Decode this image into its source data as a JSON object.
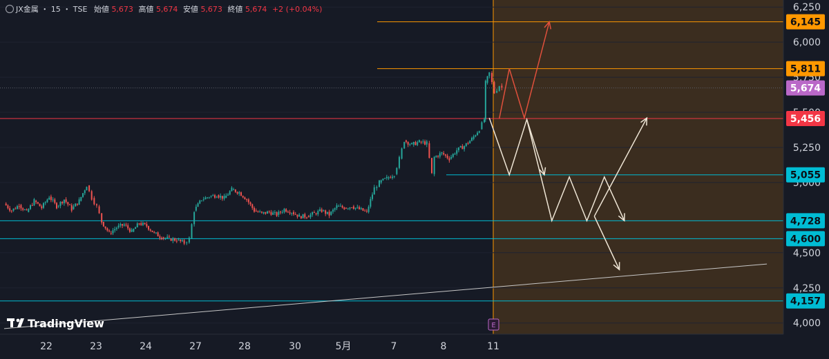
{
  "header": {
    "symbol": "JX金属",
    "interval": "15",
    "exchange": "TSE",
    "sep": "・",
    "open_label": "始値",
    "open_value": "5,673",
    "high_label": "高値",
    "high_value": "5,674",
    "low_label": "安値",
    "low_value": "5,673",
    "close_label": "終値",
    "close_value": "5,674",
    "change": "+2 (+0.04%)"
  },
  "logo": {
    "text": "TradingView"
  },
  "event_marker": {
    "label": "E"
  },
  "chart_data": {
    "type": "candlestick",
    "x_ticks": [
      "22",
      "23",
      "24",
      "27",
      "28",
      "30",
      "5月",
      "7",
      "8",
      "11"
    ],
    "y_ticks": [
      4000,
      4250,
      4500,
      5000,
      5250,
      5500,
      5750,
      6000,
      6250
    ],
    "y_tick_labels": [
      "4,000",
      "4,250",
      "4,500",
      "5,000",
      "5,250",
      "5,500",
      "5,750",
      "6,000",
      "6,250"
    ],
    "ylim": [
      3920,
      6300
    ],
    "last_price": 5674,
    "horizontal_levels": [
      {
        "value": 6145,
        "label": "6,145",
        "color": "#ff9800"
      },
      {
        "value": 5811,
        "label": "5,811",
        "color": "#ff9800"
      },
      {
        "value": 5674,
        "label": "5,674",
        "color": "#ba68c8"
      },
      {
        "value": 5456,
        "label": "5,456",
        "color": "#f23645"
      },
      {
        "value": 5055,
        "label": "5,055",
        "color": "#00bcd4"
      },
      {
        "value": 4728,
        "label": "4,728",
        "color": "#00bcd4"
      },
      {
        "value": 4600,
        "label": "4,600",
        "color": "#00bcd4"
      },
      {
        "value": 4157,
        "label": "4,157",
        "color": "#00bcd4"
      }
    ],
    "price_path": [
      [
        0,
        4850
      ],
      [
        0.3,
        4800
      ],
      [
        0.6,
        4840
      ],
      [
        0.9,
        4790
      ],
      [
        1.2,
        4870
      ],
      [
        1.5,
        4820
      ],
      [
        1.8,
        4900
      ],
      [
        2.1,
        4830
      ],
      [
        2.4,
        4880
      ],
      [
        2.7,
        4810
      ],
      [
        3.0,
        4870
      ],
      [
        3.3,
        4980
      ],
      [
        3.5,
        4890
      ],
      [
        3.7,
        4830
      ],
      [
        3.9,
        4720
      ],
      [
        4.2,
        4640
      ],
      [
        4.5,
        4680
      ],
      [
        4.8,
        4700
      ],
      [
        5.1,
        4650
      ],
      [
        5.4,
        4710
      ],
      [
        5.7,
        4690
      ],
      [
        6.0,
        4640
      ],
      [
        6.3,
        4610
      ],
      [
        6.6,
        4600
      ],
      [
        6.9,
        4590
      ],
      [
        7.2,
        4570
      ],
      [
        7.4,
        4600
      ],
      [
        7.6,
        4800
      ],
      [
        7.9,
        4880
      ],
      [
        8.2,
        4900
      ],
      [
        8.5,
        4910
      ],
      [
        8.8,
        4890
      ],
      [
        9.1,
        4950
      ],
      [
        9.4,
        4930
      ],
      [
        9.7,
        4880
      ],
      [
        10.0,
        4800
      ],
      [
        10.3,
        4780
      ],
      [
        10.6,
        4790
      ],
      [
        10.9,
        4770
      ],
      [
        11.2,
        4810
      ],
      [
        11.5,
        4790
      ],
      [
        11.8,
        4760
      ],
      [
        12.1,
        4760
      ],
      [
        12.4,
        4780
      ],
      [
        12.7,
        4800
      ],
      [
        13.0,
        4770
      ],
      [
        13.3,
        4830
      ],
      [
        13.6,
        4820
      ],
      [
        13.9,
        4830
      ],
      [
        14.2,
        4810
      ],
      [
        14.5,
        4790
      ],
      [
        14.8,
        4960
      ],
      [
        15.0,
        5000
      ],
      [
        15.3,
        5030
      ],
      [
        15.6,
        5060
      ],
      [
        15.8,
        5170
      ],
      [
        16.0,
        5300
      ],
      [
        16.3,
        5270
      ],
      [
        16.6,
        5290
      ],
      [
        16.9,
        5280
      ],
      [
        17.1,
        5060
      ],
      [
        17.2,
        5180
      ],
      [
        17.5,
        5210
      ],
      [
        17.8,
        5170
      ],
      [
        18.1,
        5230
      ],
      [
        18.4,
        5260
      ],
      [
        18.7,
        5310
      ],
      [
        19.0,
        5380
      ],
      [
        19.2,
        5450
      ],
      [
        19.25,
        5710
      ],
      [
        19.4,
        5780
      ],
      [
        19.6,
        5640
      ],
      [
        19.8,
        5690
      ],
      [
        19.9,
        5674
      ]
    ],
    "volume_note": "",
    "projections": {
      "red": [
        [
          19.8,
          5456
        ],
        [
          20.2,
          5811
        ],
        [
          20.8,
          5460
        ],
        [
          21.8,
          6145
        ]
      ],
      "white_a": [
        [
          19.4,
          5460
        ],
        [
          20.2,
          5055
        ],
        [
          20.9,
          5450
        ],
        [
          21.6,
          5055
        ]
      ],
      "white_b": [
        [
          20.9,
          5450
        ],
        [
          21.9,
          4728
        ],
        [
          22.6,
          5040
        ],
        [
          23.3,
          4728
        ],
        [
          24.0,
          5040
        ],
        [
          24.8,
          4728
        ]
      ],
      "white_c": [
        [
          23.6,
          4760
        ],
        [
          24.6,
          4380
        ]
      ],
      "white_d": [
        [
          23.6,
          4760
        ],
        [
          25.7,
          5460
        ]
      ],
      "trend": [
        [
          0,
          3960
        ],
        [
          30.5,
          4420
        ]
      ]
    }
  }
}
